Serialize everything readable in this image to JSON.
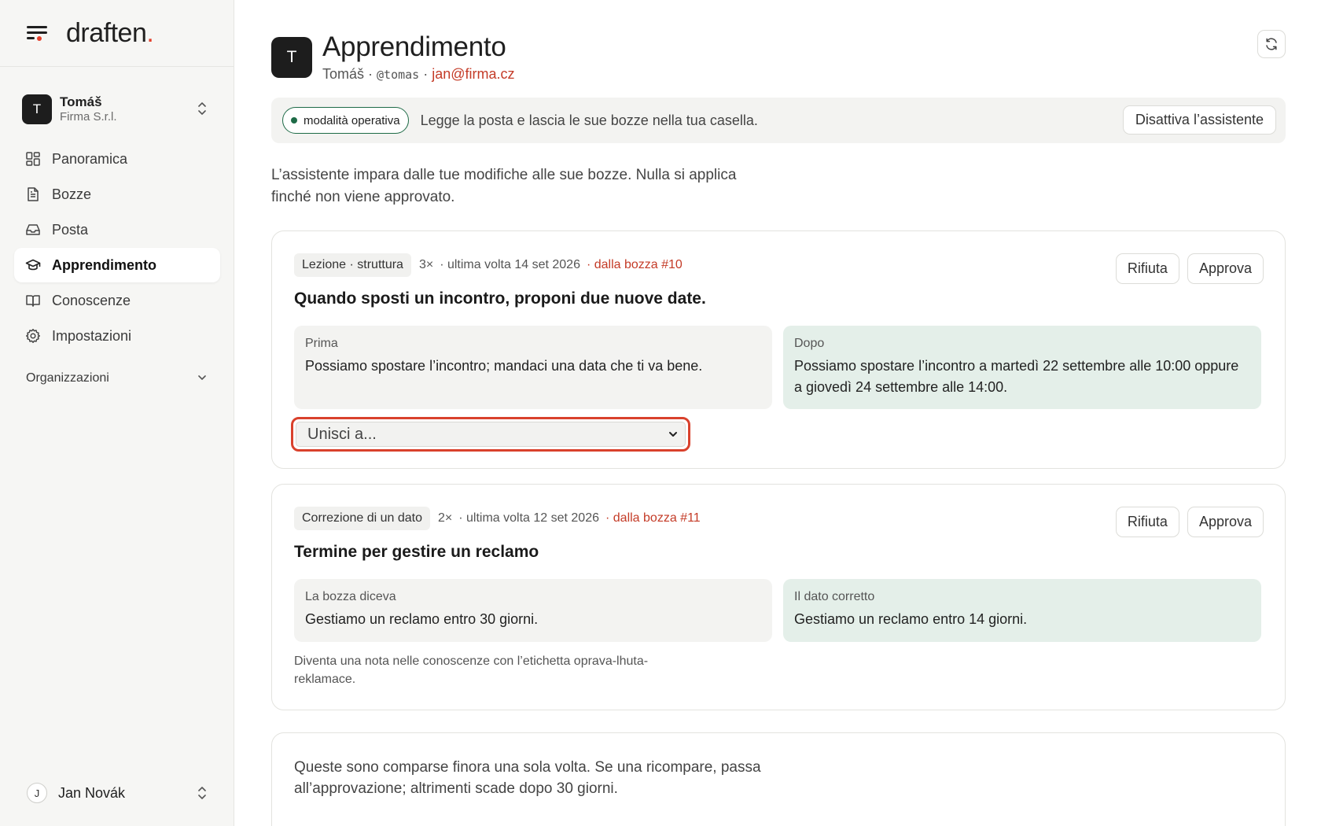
{
  "brand": {
    "name": "draften",
    "dot": "."
  },
  "account": {
    "initial": "T",
    "name": "Tomáš",
    "org": "Firma S.r.l."
  },
  "nav": {
    "items": [
      {
        "label": "Panoramica",
        "icon": "dashboard-icon"
      },
      {
        "label": "Bozze",
        "icon": "document-icon"
      },
      {
        "label": "Posta",
        "icon": "inbox-icon"
      },
      {
        "label": "Apprendimento",
        "icon": "graduation-cap-icon",
        "active": true
      },
      {
        "label": "Conoscenze",
        "icon": "book-icon"
      },
      {
        "label": "Impostazioni",
        "icon": "gear-icon"
      }
    ],
    "section": "Organizzazioni"
  },
  "user": {
    "initial": "J",
    "name": "Jan Novák"
  },
  "header": {
    "initial": "T",
    "title": "Apprendimento",
    "name": "Tomáš",
    "sep1": " · ",
    "handle": "@tomas",
    "sep2": " · ",
    "email": "jan@firma.cz"
  },
  "status": {
    "mode": "modalità operativa",
    "text": "Legge la posta e lascia le sue bozze nella tua casella.",
    "deactivate": "Disattiva l’assistente"
  },
  "intro": "L’assistente impara dalle tue modifiche alle sue bozze. Nulla si applica finché non viene approvato.",
  "cards": [
    {
      "tag": "Lezione · struttura",
      "count": "3×",
      "last": "· ultima volta 14 set 2026",
      "source": "· dalla bozza #10",
      "title": "Quando sposti un incontro, proponi due nuove date.",
      "before_label": "Prima",
      "before_text": "Possiamo spostare l’incontro; mandaci una data che ti va bene.",
      "after_label": "Dopo",
      "after_text": "Possiamo spostare l’incontro a martedì 22 settembre alle 10:00 oppure a giovedì 24 settembre alle 14:00.",
      "merge_placeholder": "Unisci a...",
      "reject": "Rifiuta",
      "approve": "Approva"
    },
    {
      "tag": "Correzione di un dato",
      "count": "2×",
      "last": "· ultima volta 12 set 2026",
      "source": "· dalla bozza #11",
      "title": "Termine per gestire un reclamo",
      "before_label": "La bozza diceva",
      "before_text": "Gestiamo un reclamo entro 30 giorni.",
      "after_label": "Il dato corretto",
      "after_text": "Gestiamo un reclamo entro 14 giorni.",
      "note": "Diventa una nota nelle conoscenze con l’etichetta oprava-lhuta-reklamace.",
      "reject": "Rifiuta",
      "approve": "Approva"
    }
  ],
  "pending": {
    "text": "Queste sono comparse finora una sola volta. Se una ricompare, passa all’approvazione; altrimenti scade dopo 30 giorni."
  }
}
